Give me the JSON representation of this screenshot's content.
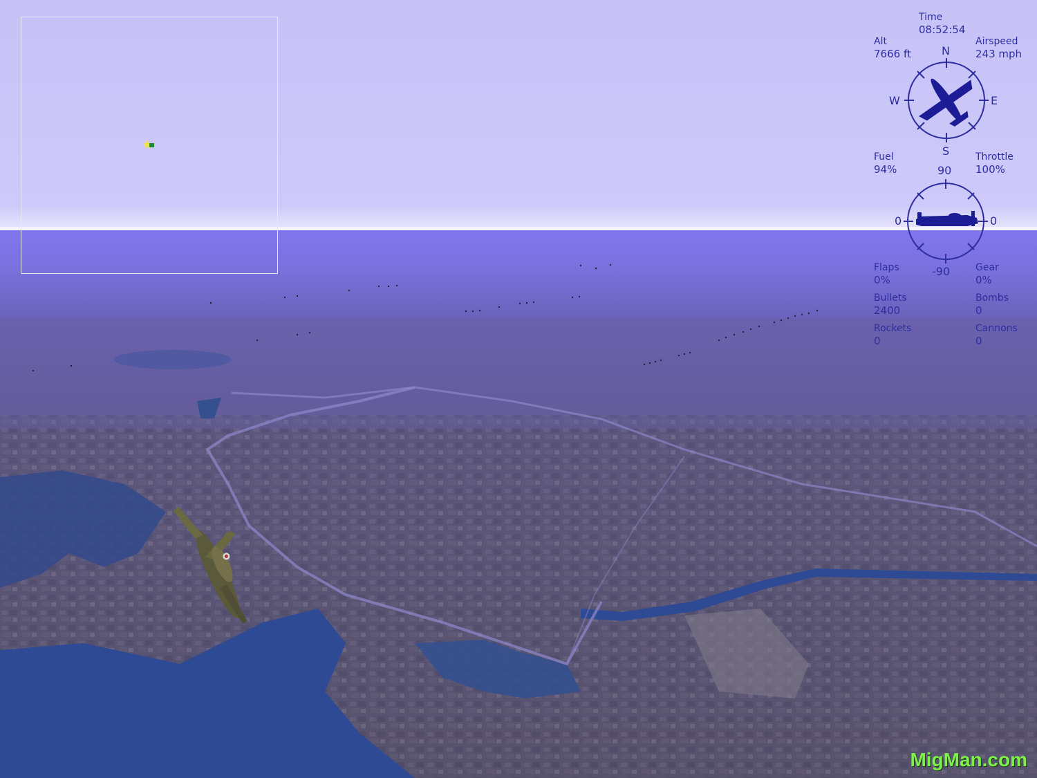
{
  "hud": {
    "time_label": "Time",
    "time_value": "08:52:54",
    "alt_label": "Alt",
    "alt_value": "7666 ft",
    "airspeed_label": "Airspeed",
    "airspeed_value": "243 mph",
    "compass": {
      "n": "N",
      "s": "S",
      "e": "E",
      "w": "W"
    },
    "fuel_label": "Fuel",
    "fuel_value": "94%",
    "throttle_label": "Throttle",
    "throttle_value": "100%",
    "pitch": {
      "top": "90",
      "bottom": "-90",
      "left": "0",
      "right": "0"
    },
    "flaps_label": "Flaps",
    "flaps_value": "0%",
    "gear_label": "Gear",
    "gear_value": "0%",
    "bullets_label": "Bullets",
    "bullets_value": "2400",
    "bombs_label": "Bombs",
    "bombs_value": "0",
    "rockets_label": "Rockets",
    "rockets_value": "0",
    "cannons_label": "Cannons",
    "cannons_value": "0"
  },
  "watermark": "MigMan.com",
  "colors": {
    "hud": "#2e2ea0",
    "sky": "#c8c4f8",
    "watermark": "#7ef04a"
  },
  "icons": [
    "compass-icon",
    "aircraft-heading-icon",
    "aircraft-pitch-icon",
    "player-marker-icon",
    "spitfire-aircraft"
  ]
}
